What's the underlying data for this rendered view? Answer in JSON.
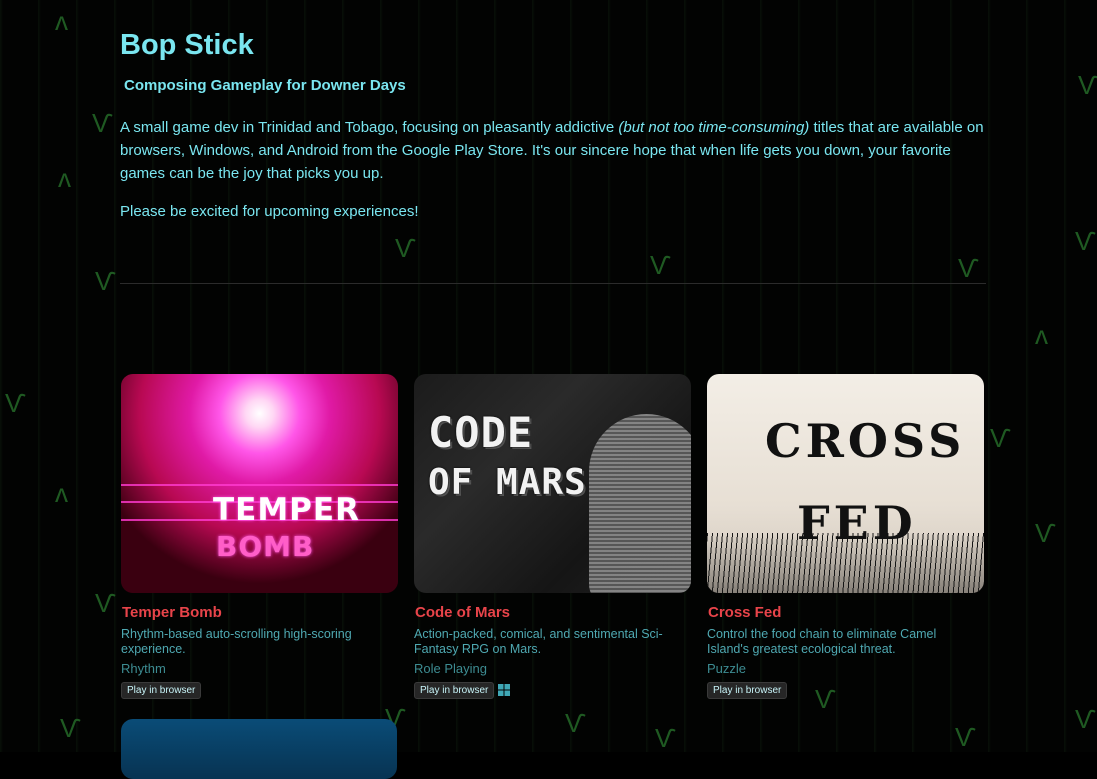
{
  "header": {
    "title": "Bop Stick",
    "subtitle": "Composing Gameplay for Downer Days"
  },
  "intro": {
    "part1": "A small game dev in Trinidad and Tobago, focusing on pleasantly addictive ",
    "emphasis": "(but not too time-consuming)",
    "part2": " titles that are available on browsers, Windows, and Android from the Google Play Store. It's our sincere hope that when life gets you down, your favorite games can be the joy that picks you up.",
    "excited": "Please be excited for upcoming experiences!"
  },
  "games": [
    {
      "title": "Temper Bomb",
      "description": "Rhythm-based auto-scrolling high-scoring experience.",
      "genre": "Rhythm",
      "badge": "Play in browser",
      "art_line1": "TEMPER",
      "art_line2": "BOMB"
    },
    {
      "title": "Code of Mars",
      "description": "Action-packed, comical, and sentimental Sci-Fantasy RPG on Mars.",
      "genre": "Role Playing",
      "badge": "Play in browser",
      "platform_icon": "windows-icon",
      "art_line1": "CODE",
      "art_line2": "OF MARS"
    },
    {
      "title": "Cross Fed",
      "description": "Control the food chain to eliminate Camel Island's greatest ecological threat.",
      "genre": "Puzzle",
      "badge": "Play in browser",
      "art_line1": "CROSS",
      "art_line2": "FED"
    }
  ],
  "colors": {
    "accent": "#7ae6f0",
    "game_title": "#e8444a",
    "description": "#4fa9b2",
    "background": "#000000"
  }
}
